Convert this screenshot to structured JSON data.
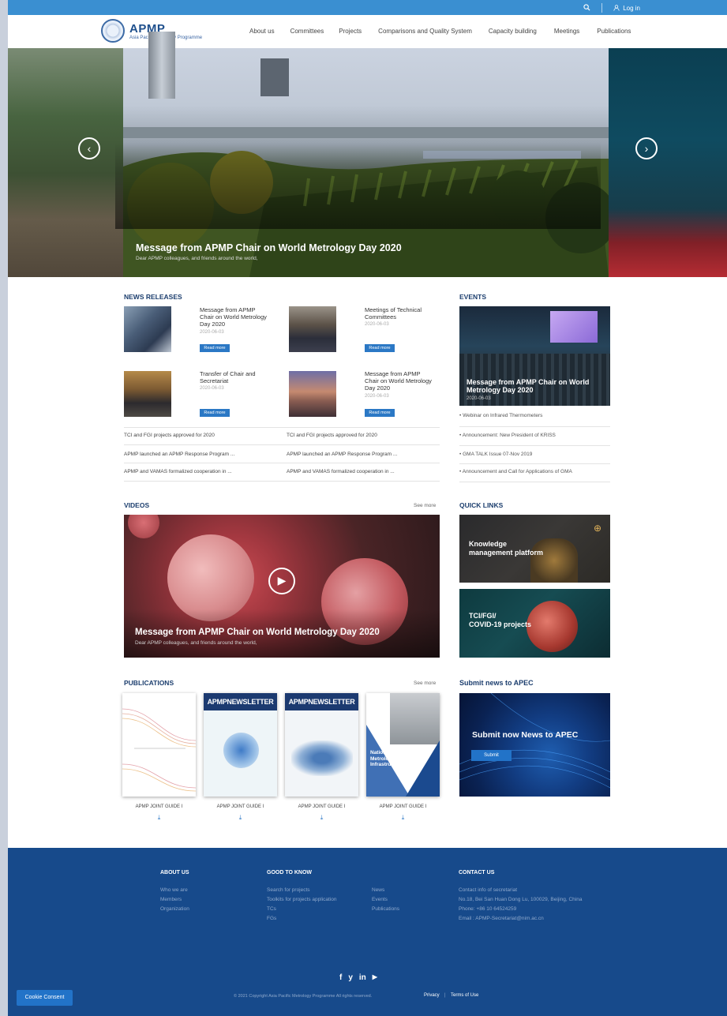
{
  "topbar": {
    "login_label": "Log in"
  },
  "brand": {
    "name": "APMP",
    "tagline": "Asia Pacific Metrology Programme"
  },
  "nav": [
    "About us",
    "Committees",
    "Projects",
    "Comparisons and Quality System",
    "Capacity building",
    "Meetings",
    "Publications"
  ],
  "hero": {
    "title": "Message from APMP Chair on World Metrology Day 2020",
    "subtitle": "Dear APMP colleagues, and friends around the world,"
  },
  "news": {
    "heading": "NEWS RELEASES",
    "cards": [
      {
        "title": "Message from APMP Chair on World Metrology Day 2020",
        "date": "2020-06-03",
        "button": "Read more"
      },
      {
        "title": "Meetings of Technical Committees",
        "date": "2020-06-03",
        "button": "Read more"
      },
      {
        "title": "Transfer of Chair and Secretariat",
        "date": "2020-06-03",
        "button": "Read more"
      },
      {
        "title": "Message from APMP Chair on World Metrology Day 2020",
        "date": "2020-06-03",
        "button": "Read more"
      }
    ],
    "list_left": [
      "TCI and FGI projects approved for 2020",
      "APMP launched an APMP Response Program ...",
      "APMP and VAMAS formalized cooperation in ..."
    ],
    "list_right": [
      "TCI and FGI projects approved for 2020",
      "APMP launched an APMP Response Program ...",
      "APMP and VAMAS formalized cooperation in ..."
    ]
  },
  "events": {
    "heading": "EVENTS",
    "feature_title": "Message from APMP Chair on World Metrology Day 2020",
    "feature_date": "2020-06-03",
    "items": [
      "Webinar on Infrared Thermometers",
      "Announcement: New President of KRISS",
      "GMA TALK Issue 07-Nov 2019",
      "Announcement and Call for Applications of GMA"
    ]
  },
  "videos": {
    "heading": "VIDEOS",
    "see_more": "See more",
    "title": "Message from APMP Chair on World Metrology Day 2020",
    "subtitle": "Dear APMP colleagues, and friends around the world,"
  },
  "quick_links": {
    "heading": "QUICK LINKS",
    "items": [
      {
        "line1": "Knowledge",
        "line2": "management platform"
      },
      {
        "line1": "TCI/FGI/",
        "line2": "COVID-19 projects"
      }
    ]
  },
  "publications": {
    "heading": "PUBLICATIONS",
    "see_more": "See more",
    "items": [
      {
        "caption": "APMP JOINT GUIDE I"
      },
      {
        "caption": "APMP JOINT GUIDE I",
        "banner": "APMPNEWSLETTER"
      },
      {
        "caption": "APMP JOINT GUIDE I",
        "banner": "APMPNEWSLETTER"
      },
      {
        "caption": "APMP JOINT GUIDE I",
        "cover_text": "National Metrological Infrastructure"
      }
    ]
  },
  "apec": {
    "heading": "Submit news to APEC",
    "banner_text": "Submit now News to APEC",
    "button": "Submit"
  },
  "footer": {
    "about": {
      "heading": "ABOUT US",
      "links": [
        "Who we are",
        "Members",
        "Organization"
      ]
    },
    "good": {
      "heading": "GOOD TO KNOW",
      "links_a": [
        "Search for projects",
        "Toolkits for projects application",
        "TCs",
        "FGs"
      ],
      "links_b": [
        "News",
        "Events",
        "Publications"
      ]
    },
    "contact": {
      "heading": "CONTACT US",
      "lines": [
        "Contact info of secretariat",
        "No.18, Bei San Huan Dong Lu, 100029, Beijing, China",
        "Phone:  +86 10 64524259",
        "Email : APMP-Secretariat@nim.ac.cn"
      ]
    },
    "social": [
      "f",
      "y",
      "in",
      "▶"
    ],
    "copyright": "© 2021 Copyright  Asia Pacific Metrology Programme All rights reserved.",
    "privacy": "Privacy",
    "terms": "Terms of Use"
  },
  "cookie": {
    "label": "Cookie Consent"
  }
}
